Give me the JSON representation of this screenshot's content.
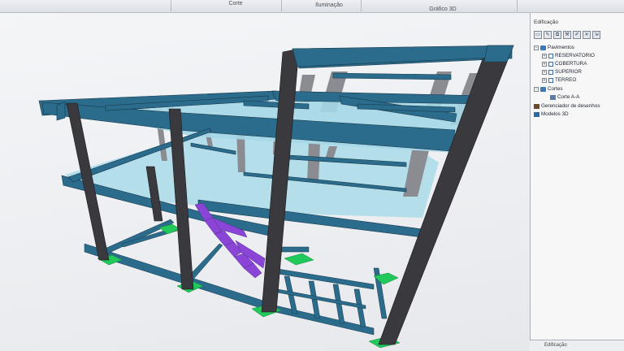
{
  "toolbar": {
    "groups": [
      "Corte",
      "Iluminação",
      "Gráfico 3D"
    ]
  },
  "panel": {
    "title": "Edificação",
    "footer": "Edificação",
    "tree": {
      "pavimentos": "Pavimentos",
      "reservatorio": "RESERVATORIO",
      "cobertura": "COBERTURA",
      "superior": "SUPERIOR",
      "terreo": "TERREO",
      "cortes": "Cortes",
      "corte_aa": "Corte A-A",
      "gerenciador": "Gerenciador de desenhos",
      "modelos": "Modelos 3D"
    }
  },
  "colors": {
    "beam": "#2b6c8c",
    "beam_dark": "#1d4c66",
    "slab": "#9fd3e6",
    "column": "#3a3a3e",
    "foundation": "#21c85a",
    "stair": "#8b45d6"
  }
}
